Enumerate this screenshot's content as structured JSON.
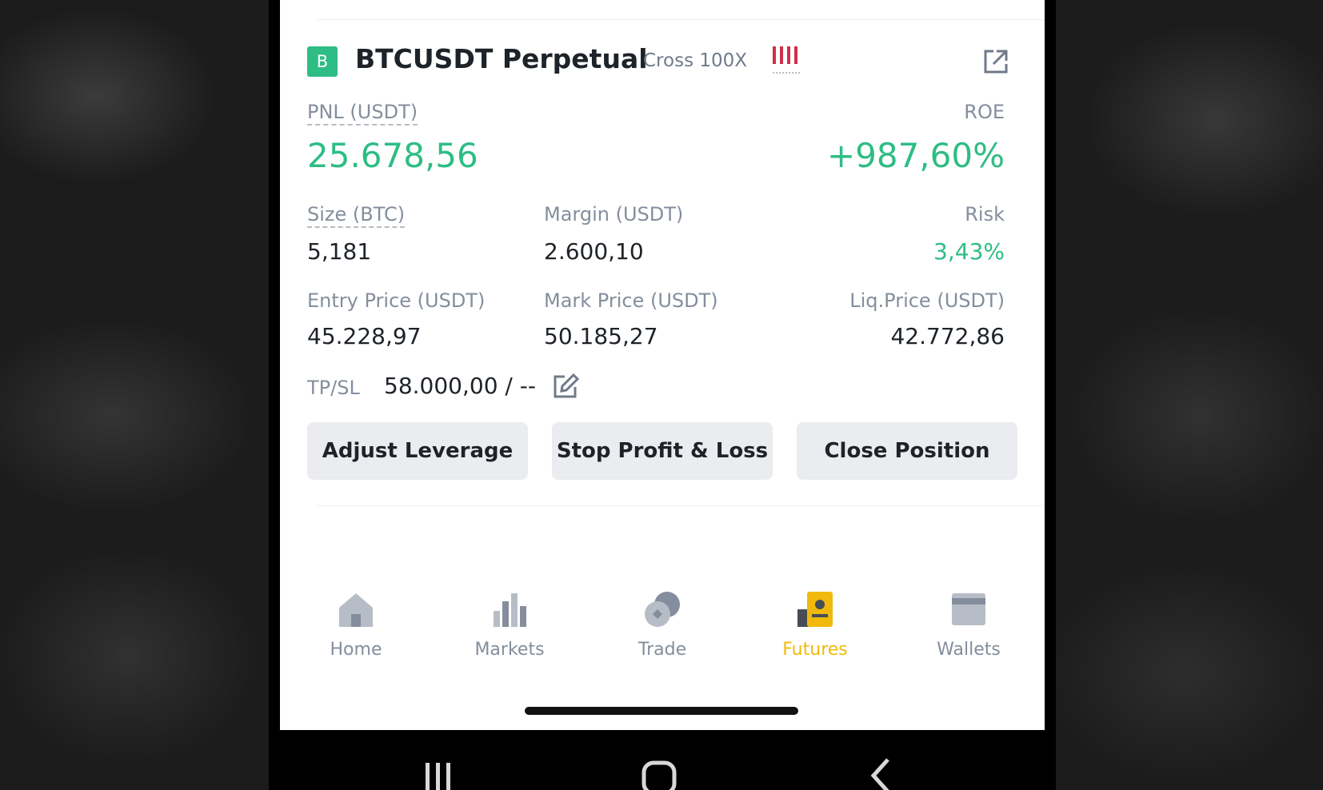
{
  "position": {
    "badge": "B",
    "symbol": "BTCUSDT Perpetual",
    "mode": "Cross 100X",
    "pnl_label": "PNL (USDT)",
    "pnl_value": "25.678,56",
    "roe_label": "ROE",
    "roe_value": "+987,60%",
    "size_label": "Size (BTC)",
    "size_value": "5,181",
    "margin_label": "Margin (USDT)",
    "margin_value": "2.600,10",
    "risk_label": "Risk",
    "risk_value": "3,43%",
    "entry_label": "Entry Price (USDT)",
    "entry_value": "45.228,97",
    "mark_label": "Mark Price (USDT)",
    "mark_value": "50.185,27",
    "liq_label": "Liq.Price (USDT)",
    "liq_value": "42.772,86",
    "tpsl_label": "TP/SL",
    "tpsl_value": "58.000,00 / --"
  },
  "buttons": {
    "adjust_leverage": "Adjust Leverage",
    "stop_profit_loss": "Stop Profit & Loss",
    "close_position": "Close Position"
  },
  "nav": {
    "items": [
      {
        "label": "Home",
        "icon": "home-icon"
      },
      {
        "label": "Markets",
        "icon": "bar-chart-icon"
      },
      {
        "label": "Trade",
        "icon": "trade-coins-icon"
      },
      {
        "label": "Futures",
        "icon": "futures-icon",
        "active": true
      },
      {
        "label": "Wallets",
        "icon": "wallet-icon"
      }
    ]
  },
  "colors": {
    "positive": "#2ebd85",
    "negative": "#cf304a",
    "active_nav": "#f0b90b",
    "text_primary": "#1e2329",
    "text_secondary": "#848e9c"
  }
}
